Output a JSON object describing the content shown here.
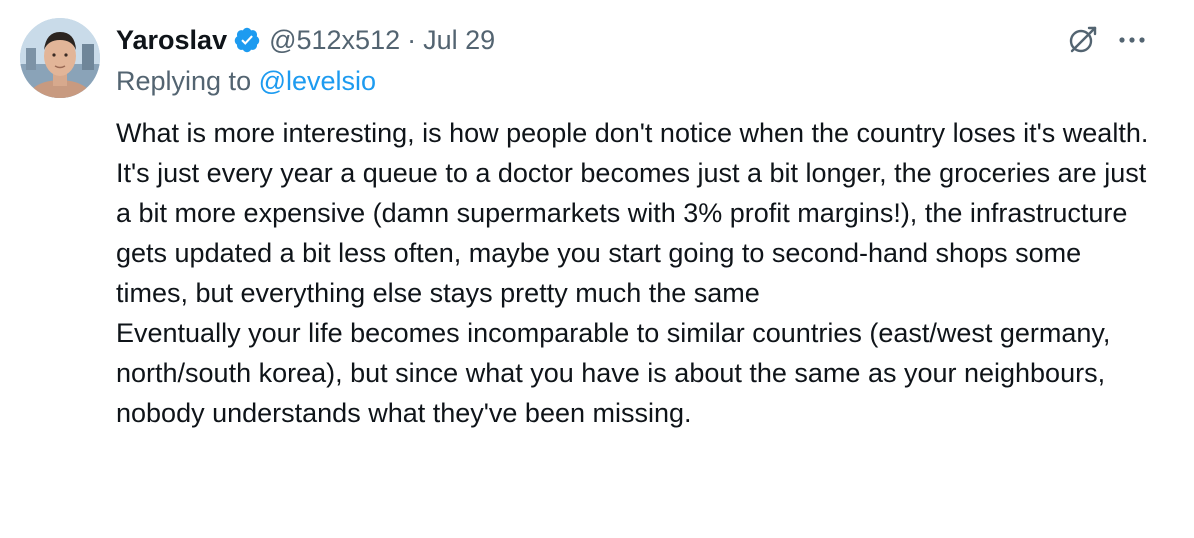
{
  "tweet": {
    "author": {
      "display_name": "Yaroslav",
      "handle": "@512x512",
      "verified": true,
      "avatar_icon": "profile-photo"
    },
    "separator": "·",
    "date": "Jul 29",
    "reply": {
      "prefix": "Replying to ",
      "to_handle": "@levelsio"
    },
    "paragraphs": [
      "What is more interesting, is how people don't notice when the country loses it's wealth.",
      "It's just every year a queue to a doctor becomes just a bit longer, the groceries are just a bit more expensive (damn supermarkets with 3% profit margins!), the infrastructure gets updated a bit less often, maybe you start going to second-hand shops some times, but everything else stays pretty much the same",
      "Eventually your life becomes incomparable to similar countries (east/west germany, north/south korea), but since what you have is about the same as your neighbours, nobody understands what they've been missing."
    ],
    "actions": {
      "grok_icon": "grok-icon",
      "more_icon": "more-icon"
    }
  },
  "colors": {
    "text": "#0f1419",
    "muted": "#536471",
    "accent": "#1d9bf0"
  }
}
